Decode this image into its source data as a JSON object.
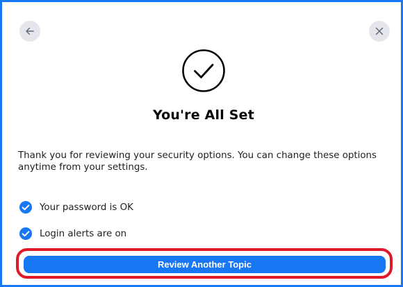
{
  "dialog": {
    "title": "You're All Set",
    "message": "Thank you for reviewing your security options. You can change these options anytime from your settings.",
    "status_items": [
      {
        "icon": "check-circle-icon",
        "label": "Your password is OK"
      },
      {
        "icon": "check-circle-icon",
        "label": "Login alerts are on"
      }
    ],
    "primary_button_label": "Review Another Topic"
  },
  "icons": {
    "back": "arrow-left-icon",
    "close": "close-icon",
    "hero": "check-circle-outline-icon"
  },
  "colors": {
    "accent": "#1877f2",
    "highlight": "#e01928",
    "nav_button_bg": "#e4e6eb",
    "text_primary": "#050505"
  }
}
